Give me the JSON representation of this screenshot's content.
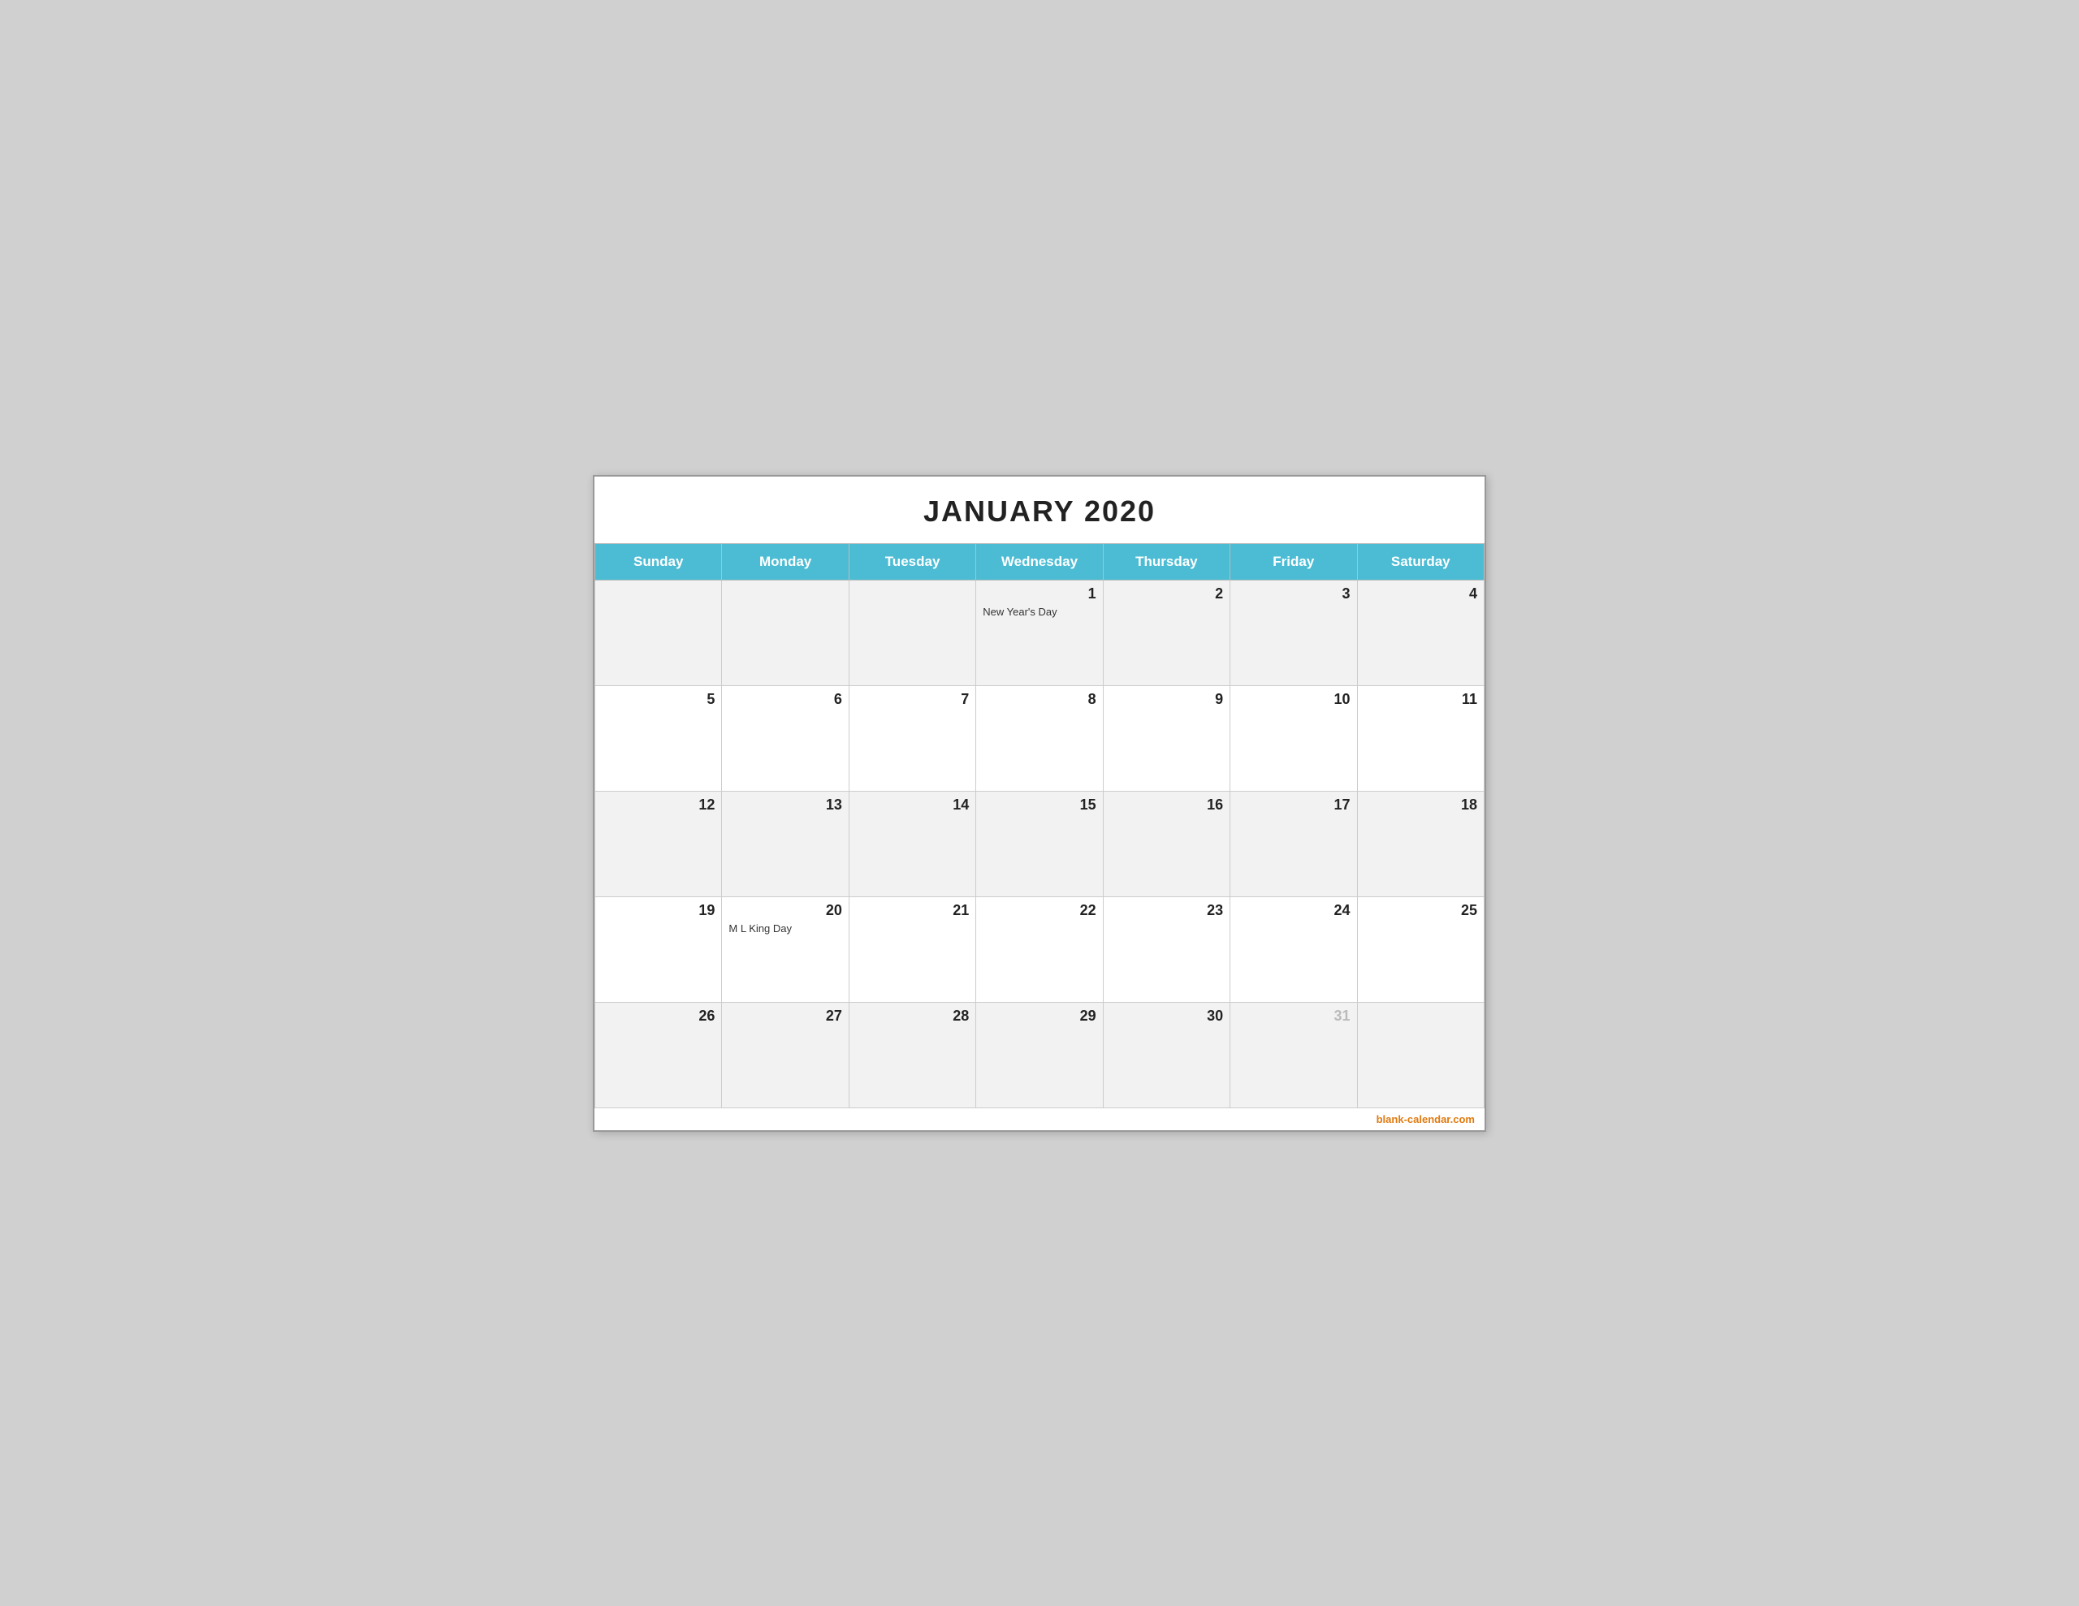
{
  "calendar": {
    "title": "JANUARY 2020",
    "days_of_week": [
      "Sunday",
      "Monday",
      "Tuesday",
      "Wednesday",
      "Thursday",
      "Friday",
      "Saturday"
    ],
    "weeks": [
      {
        "shade": true,
        "days": [
          {
            "number": "",
            "event": "",
            "faded": false,
            "empty": true
          },
          {
            "number": "",
            "event": "",
            "faded": false,
            "empty": true
          },
          {
            "number": "",
            "event": "",
            "faded": false,
            "empty": true
          },
          {
            "number": "1",
            "event": "New Year's Day",
            "faded": false,
            "empty": false
          },
          {
            "number": "2",
            "event": "",
            "faded": false,
            "empty": false
          },
          {
            "number": "3",
            "event": "",
            "faded": false,
            "empty": false
          },
          {
            "number": "4",
            "event": "",
            "faded": false,
            "empty": false
          }
        ]
      },
      {
        "shade": false,
        "days": [
          {
            "number": "5",
            "event": "",
            "faded": false,
            "empty": false
          },
          {
            "number": "6",
            "event": "",
            "faded": false,
            "empty": false
          },
          {
            "number": "7",
            "event": "",
            "faded": false,
            "empty": false
          },
          {
            "number": "8",
            "event": "",
            "faded": false,
            "empty": false
          },
          {
            "number": "9",
            "event": "",
            "faded": false,
            "empty": false
          },
          {
            "number": "10",
            "event": "",
            "faded": false,
            "empty": false
          },
          {
            "number": "11",
            "event": "",
            "faded": false,
            "empty": false
          }
        ]
      },
      {
        "shade": true,
        "days": [
          {
            "number": "12",
            "event": "",
            "faded": false,
            "empty": false
          },
          {
            "number": "13",
            "event": "",
            "faded": false,
            "empty": false
          },
          {
            "number": "14",
            "event": "",
            "faded": false,
            "empty": false
          },
          {
            "number": "15",
            "event": "",
            "faded": false,
            "empty": false
          },
          {
            "number": "16",
            "event": "",
            "faded": false,
            "empty": false
          },
          {
            "number": "17",
            "event": "",
            "faded": false,
            "empty": false
          },
          {
            "number": "18",
            "event": "",
            "faded": false,
            "empty": false
          }
        ]
      },
      {
        "shade": false,
        "days": [
          {
            "number": "19",
            "event": "",
            "faded": false,
            "empty": false
          },
          {
            "number": "20",
            "event": "M L King Day",
            "faded": false,
            "empty": false
          },
          {
            "number": "21",
            "event": "",
            "faded": false,
            "empty": false
          },
          {
            "number": "22",
            "event": "",
            "faded": false,
            "empty": false
          },
          {
            "number": "23",
            "event": "",
            "faded": false,
            "empty": false
          },
          {
            "number": "24",
            "event": "",
            "faded": false,
            "empty": false
          },
          {
            "number": "25",
            "event": "",
            "faded": false,
            "empty": false
          }
        ]
      },
      {
        "shade": true,
        "days": [
          {
            "number": "26",
            "event": "",
            "faded": false,
            "empty": false
          },
          {
            "number": "27",
            "event": "",
            "faded": false,
            "empty": false
          },
          {
            "number": "28",
            "event": "",
            "faded": false,
            "empty": false
          },
          {
            "number": "29",
            "event": "",
            "faded": false,
            "empty": false
          },
          {
            "number": "30",
            "event": "",
            "faded": false,
            "empty": false
          },
          {
            "number": "31",
            "event": "",
            "faded": true,
            "empty": false
          },
          {
            "number": "",
            "event": "",
            "faded": false,
            "empty": true
          }
        ]
      }
    ],
    "footer": "blank-calendar.com"
  }
}
